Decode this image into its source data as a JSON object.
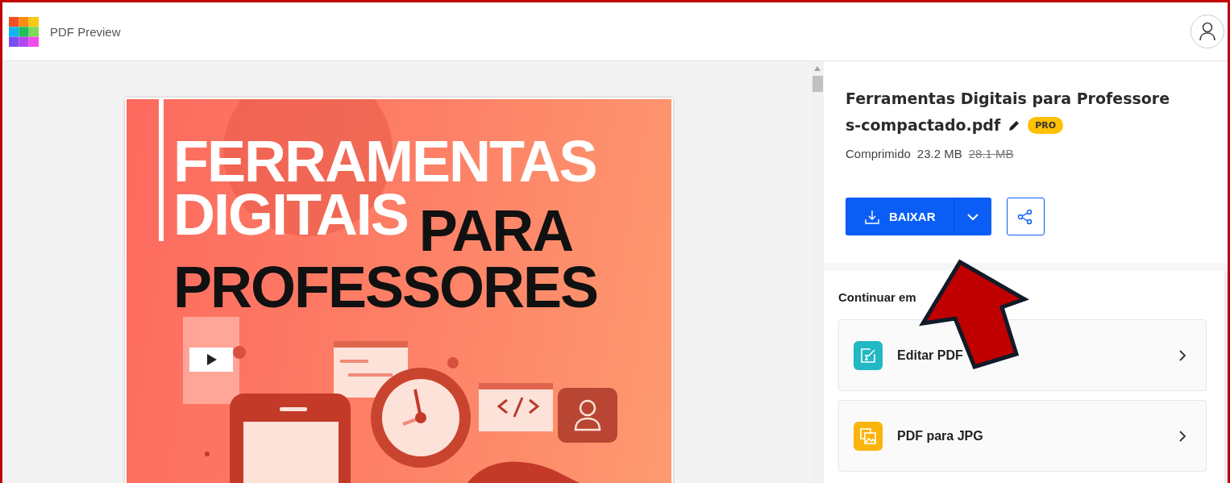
{
  "app": {
    "title": "PDF Preview"
  },
  "document_page": {
    "title_rows": [
      [
        {
          "text": "FERRAMENTAS",
          "color": "#ffffff"
        }
      ],
      [
        {
          "text": "DIGITAIS",
          "color": "#ffffff"
        },
        {
          "text": "PARA",
          "color": "#111111"
        }
      ],
      [
        {
          "text": "PROFESSORES",
          "color": "#111111"
        }
      ]
    ]
  },
  "file": {
    "name_lines": [
      "Ferramentas Digitais para Professore",
      "s-compactado.pdf"
    ],
    "badge": "PRO",
    "status": "Comprimido",
    "size": "23.2 MB",
    "original_size": "28.1 MB"
  },
  "download_button": {
    "label": "BAIXAR"
  },
  "continue": {
    "heading": "Continuar em",
    "tools": [
      {
        "label": "Editar PDF",
        "kind": "edit",
        "color": "#22b8c4"
      },
      {
        "label": "PDF para JPG",
        "kind": "image",
        "color": "#fbb40c"
      }
    ]
  }
}
